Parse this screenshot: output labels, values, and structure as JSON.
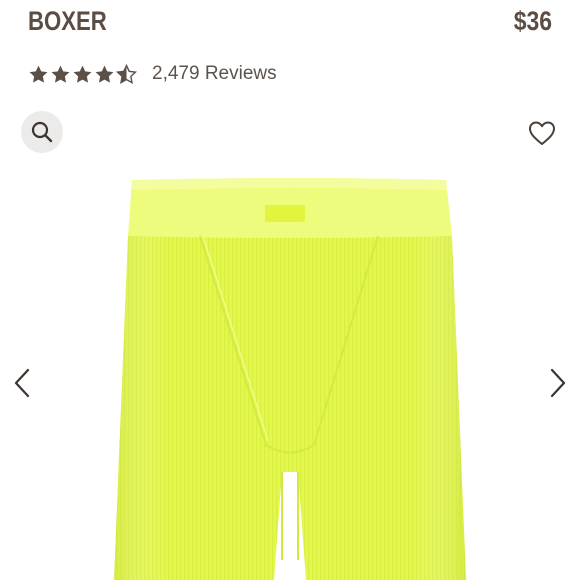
{
  "product": {
    "title": "BOXER",
    "price": "$36",
    "rating_value": 4.5,
    "rating_max": 5,
    "reviews_label": "2,479 Reviews",
    "image_alt_color": "#e9fb4a"
  },
  "icons": {
    "search": "search-icon",
    "favorite": "heart-icon",
    "prev": "chevron-left-icon",
    "next": "chevron-right-icon",
    "star": "star-icon"
  },
  "colors": {
    "text": "#5b4d44",
    "star": "#5c4f47",
    "button_bg": "#ecebea",
    "product_fabric": "#e6f84a",
    "product_waistband": "#eefc78"
  }
}
